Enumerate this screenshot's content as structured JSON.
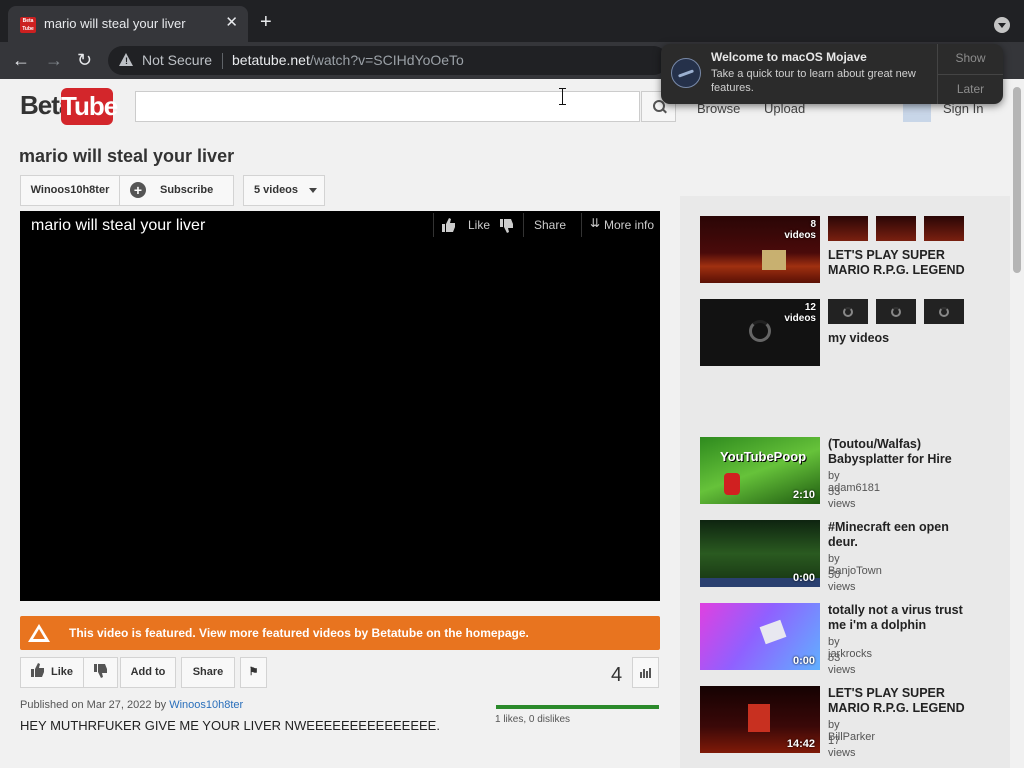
{
  "browser": {
    "tab_title": "mario will steal your liver",
    "favicon_text": "Beta Tube",
    "close_glyph": "✕",
    "new_tab_glyph": "+",
    "back_glyph": "←",
    "forward_glyph": "→",
    "reload_glyph": "↻",
    "security_label": "Not Secure",
    "url_domain": "betatube.net",
    "url_path": "/watch?v=SCIHdYoOeTo"
  },
  "site": {
    "logo_beta": "Beta",
    "logo_tube": "Tube",
    "search_placeholder": "",
    "nav": {
      "browse": "Browse",
      "upload": "Upload",
      "sign_in": "Sign In"
    }
  },
  "video": {
    "title": "mario will steal your liver",
    "channel": "Winoos10h8ter",
    "subscribe_label": "Subscribe",
    "videos_label": "5 videos",
    "player": {
      "title": "mario will steal your liver",
      "like_label": "Like",
      "share_label": "Share",
      "more_info_label": "More info"
    },
    "featured_banner": "This video is featured. View more featured videos by Betatube on the homepage.",
    "actions": {
      "like": "Like",
      "add_to": "Add to",
      "share": "Share"
    },
    "view_count": "4",
    "published_prefix": "Published on Mar 27, 2022 by",
    "published_by": "Winoos10h8ter",
    "description": "HEY MUTHRFUKER GIVE ME YOUR LIVER NWEEEEEEEEEEEEEEE.",
    "like_fraction": 1.0,
    "like_summary": "1 likes, 0 dislikes"
  },
  "sidebar": {
    "playlists": [
      {
        "count_line1": "8",
        "count_line2": "videos",
        "title": "LET'S PLAY SUPER MARIO R.P.G. LEGEND"
      },
      {
        "count_line1": "12",
        "count_line2": "videos",
        "title": "my videos"
      }
    ],
    "videos": [
      {
        "title": "(Toutou/Walfas) Babysplatter for Hire",
        "by": "by adam6181",
        "views": "53 views",
        "duration": "2:10",
        "thumb_text": "YouTubePoop"
      },
      {
        "title": "#Minecraft een open deur.",
        "by": "by BanjoTown",
        "views": "50 views",
        "duration": "0:00"
      },
      {
        "title": "totally not a virus trust me i'm a dolphin",
        "by": "by jarkrocks",
        "views": "53 views",
        "duration": "0:00"
      },
      {
        "title": "LET'S PLAY SUPER MARIO R.P.G. LEGEND",
        "by": "by BillParker",
        "views": "17 views",
        "duration": "14:42"
      }
    ]
  },
  "notification": {
    "title": "Welcome to macOS Mojave",
    "body": "Take a quick tour to learn about great new features.",
    "show_label": "Show",
    "later_label": "Later"
  },
  "colors": {
    "featured": "#e8741f",
    "logo_red": "#d3262b",
    "like_bar": "#2b8a2b",
    "link": "#2a6fbb"
  }
}
